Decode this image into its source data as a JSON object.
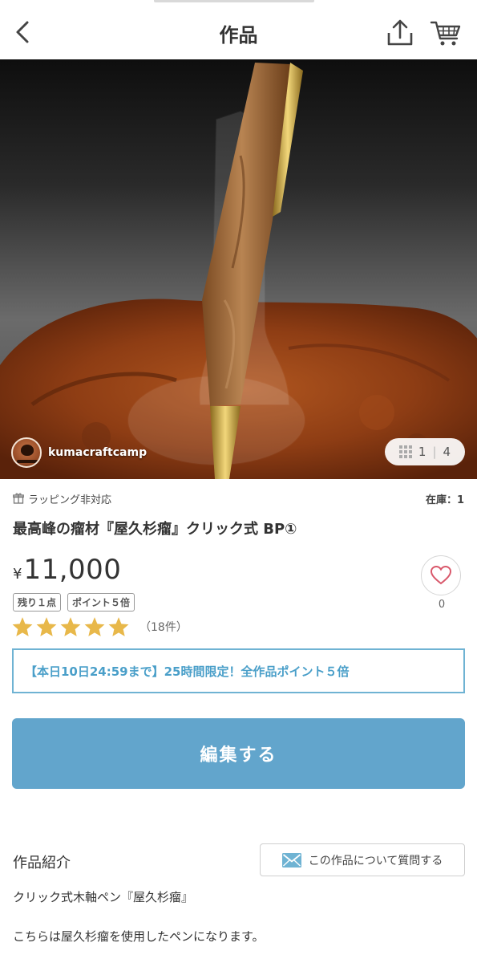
{
  "header": {
    "title": "作品",
    "back_icon": "chevron-left-icon",
    "share_icon": "share-icon",
    "cart_icon": "cart-icon"
  },
  "gallery": {
    "seller_name": "kumacraftcamp",
    "current": "1",
    "separator": "|",
    "total": "4"
  },
  "product": {
    "wrapping_note": "ラッピング非対応",
    "stock": "在庫：1",
    "title": "最高峰の瘤材『屋久杉瘤』クリック式 BP①",
    "currency": "¥",
    "price": "11,000",
    "tags": [
      "残り１点",
      "ポイント５倍"
    ],
    "rating": {
      "stars": 5,
      "count_text": "（18件）"
    },
    "favorites": "0"
  },
  "promo": {
    "text": "【本日10日24:59まで】25時間限定！全作品ポイント５倍"
  },
  "actions": {
    "edit_label": "編集する",
    "ask_label": "この作品について質問する"
  },
  "description": {
    "heading": "作品紹介",
    "line1": "クリック式木軸ペン『屋久杉瘤』",
    "line2": "こちらは屋久杉瘤を使用したペンになります。"
  },
  "colors": {
    "accent": "#62a5cc",
    "promo_border": "#6fb3d3",
    "promo_text": "#4a9fc9",
    "star": "#e8b84a"
  }
}
